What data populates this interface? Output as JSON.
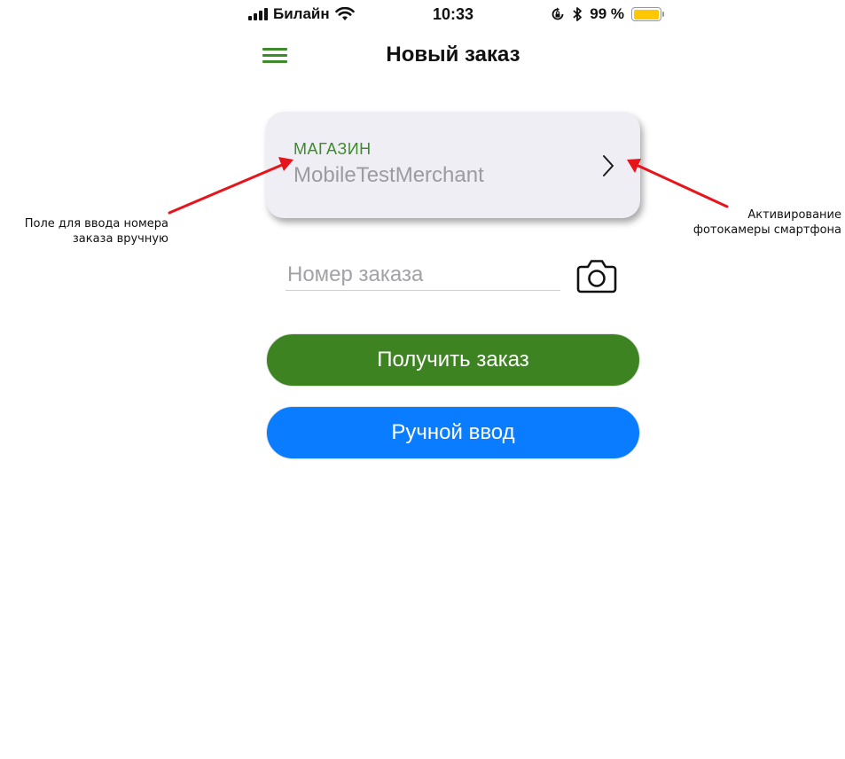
{
  "status_bar": {
    "carrier": "Билайн",
    "time": "10:33",
    "battery_text": "99 %",
    "battery_level": 0.99,
    "icons": [
      "signal-icon",
      "wifi-icon",
      "orientation-lock-icon",
      "bluetooth-icon",
      "battery-icon"
    ]
  },
  "nav": {
    "title": "Новый заказ",
    "menu_icon": "hamburger-menu-icon"
  },
  "store_card": {
    "label": "МАГАЗИН",
    "value": "MobileTestMerchant",
    "chevron_icon": "chevron-right-icon"
  },
  "order_input": {
    "placeholder": "Номер заказа",
    "value": "",
    "camera_icon": "camera-icon"
  },
  "buttons": {
    "get_order": "Получить заказ",
    "manual_entry": "Ручной ввод"
  },
  "annotations": {
    "left_line1": "Поле для ввода номера",
    "left_line2": "заказа вручную",
    "right_line1": "Активирование",
    "right_line2": "фотокамеры смартфона"
  },
  "colors": {
    "accent_green": "#3d8b2a",
    "button_green": "#3d8322",
    "button_blue": "#0a7cff",
    "card_bg": "#efeef4",
    "annotation_arrow": "#e8141b"
  }
}
